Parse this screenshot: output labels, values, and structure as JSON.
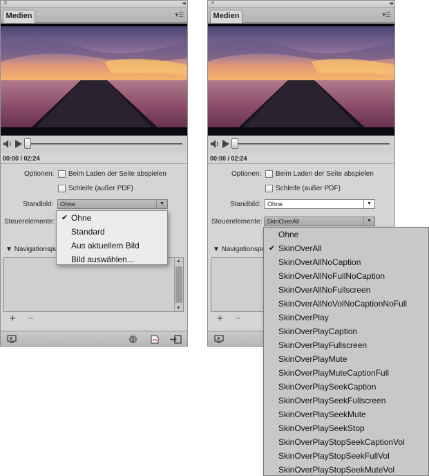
{
  "panels": [
    {
      "id": "left",
      "tab_label": "Medien",
      "timecode": "00:00 / 02:24",
      "options_label": "Optionen:",
      "autoplay_label": "Beim Laden der Seite abspielen",
      "loop_label": "Schleife (außer PDF)",
      "poster_label": "Standbild:",
      "poster_value": "Ohne",
      "controls_label": "Steuerelemente:",
      "controls_value": "",
      "nav_label": "Navigationspu",
      "add_label": "+",
      "remove_label": "−",
      "menu": {
        "for": "Standbild",
        "items": [
          "Ohne",
          "Standard",
          "Aus aktuellem Bild",
          "Bild auswählen..."
        ],
        "checked_index": 0
      }
    },
    {
      "id": "right",
      "tab_label": "Medien",
      "timecode": "00:00 / 02:24",
      "options_label": "Optionen:",
      "autoplay_label": "Beim Laden der Seite abspielen",
      "loop_label": "Schleife (außer PDF)",
      "poster_label": "Standbild:",
      "poster_value": "Ohne",
      "controls_label": "Steuerelemente:",
      "controls_value": "SkinOverAll",
      "nav_label": "Navigationspu",
      "add_label": "+",
      "remove_label": "−",
      "menu": {
        "for": "Steuerelemente",
        "items": [
          "Ohne",
          "SkinOverAll",
          "SkinOverAllNoCaption",
          "SkinOverAllNoFullNoCaption",
          "SkinOverAllNoFullscreen",
          "SkinOverAllNoVolNoCaptionNoFull",
          "SkinOverPlay",
          "SkinOverPlayCaption",
          "SkinOverPlayFullscreen",
          "SkinOverPlayMute",
          "SkinOverPlayMuteCaptionFull",
          "SkinOverPlaySeekCaption",
          "SkinOverPlaySeekFullscreen",
          "SkinOverPlaySeekMute",
          "SkinOverPlaySeekStop",
          "SkinOverPlayStopSeekCaptionVol",
          "SkinOverPlayStopSeekFullVol",
          "SkinOverPlayStopSeekMuteVol"
        ],
        "checked_index": 1
      }
    }
  ],
  "icons": {
    "close": "close-x-icon",
    "collapse": "double-chevron-icon",
    "panel_menu": "panel-menu-icon",
    "speaker": "speaker-icon",
    "play": "play-icon",
    "preview": "preview-icon",
    "browser": "globe-icon",
    "pdf": "pdf-icon",
    "export": "export-icon"
  },
  "colors": {
    "panel_bg": "#d5d5d5",
    "menu_bg": "#ececec",
    "sky_top": "#5a4f7a",
    "sunset_glow": "#f0a060"
  }
}
